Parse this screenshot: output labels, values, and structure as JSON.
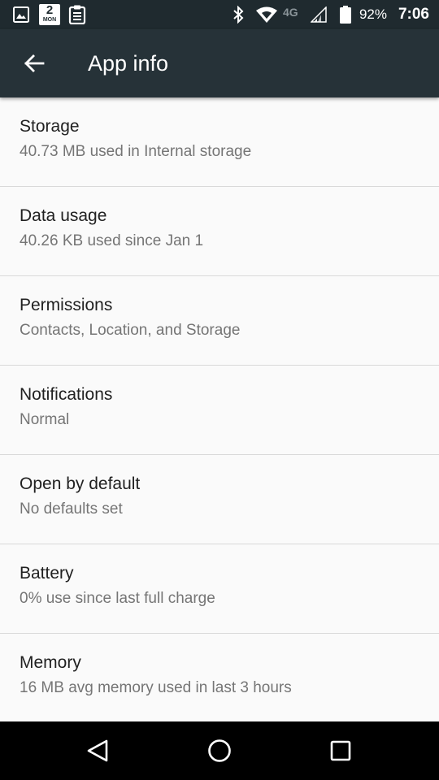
{
  "status_bar": {
    "calendar_day": "2",
    "calendar_month": "MON",
    "network_label": "4G",
    "battery_percent": "92%",
    "time": "7:06",
    "icons": [
      "image-icon",
      "calendar-icon",
      "clipboard-icon",
      "bluetooth-icon",
      "wifi-icon",
      "network-4g-icon",
      "signal-icon",
      "battery-icon"
    ]
  },
  "app_bar": {
    "title": "App info",
    "back_icon": "arrow-back-icon"
  },
  "settings": {
    "items": [
      {
        "title": "Storage",
        "subtitle": "40.73 MB used in Internal storage"
      },
      {
        "title": "Data usage",
        "subtitle": "40.26 KB used since Jan 1"
      },
      {
        "title": "Permissions",
        "subtitle": "Contacts, Location, and Storage"
      },
      {
        "title": "Notifications",
        "subtitle": "Normal"
      },
      {
        "title": "Open by default",
        "subtitle": "No defaults set"
      },
      {
        "title": "Battery",
        "subtitle": "0% use since last full charge"
      },
      {
        "title": "Memory",
        "subtitle": "16 MB avg memory used in last 3 hours"
      }
    ]
  },
  "nav_bar": {
    "icons": [
      "back-triangle-icon",
      "home-circle-icon",
      "recents-square-icon"
    ]
  },
  "colors": {
    "app_bar": "#263238",
    "status_bar": "#1f2a2f",
    "background": "#fafafa",
    "title_text": "#212121",
    "subtitle_text": "#757575"
  }
}
